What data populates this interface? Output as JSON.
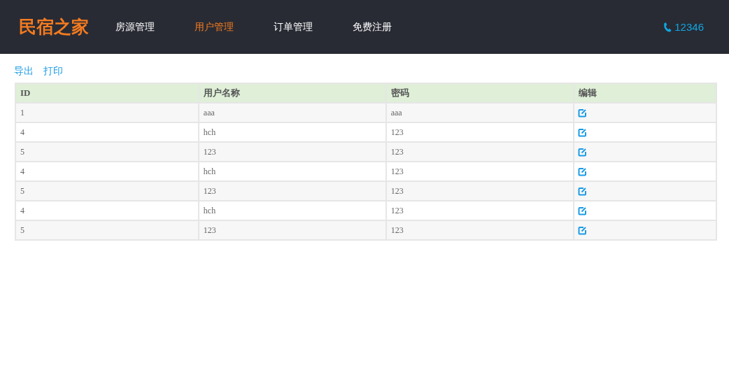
{
  "header": {
    "logo": "民宿之家",
    "nav": [
      {
        "label": "房源管理",
        "selected": false
      },
      {
        "label": "用户管理",
        "selected": true
      },
      {
        "label": "订单管理",
        "selected": false
      },
      {
        "label": "免费注册",
        "selected": false
      }
    ],
    "phone": "12346"
  },
  "actions": [
    "导出",
    "打印"
  ],
  "table": {
    "columns": [
      "ID",
      "用户名称",
      "密码",
      "编辑"
    ],
    "rows": [
      [
        "1",
        "aaa",
        "aaa"
      ],
      [
        "4",
        "hch",
        "123"
      ],
      [
        "5",
        "123",
        "123"
      ],
      [
        "4",
        "hch",
        "123"
      ],
      [
        "5",
        "123",
        "123"
      ],
      [
        "4",
        "hch",
        "123"
      ],
      [
        "5",
        "123",
        "123"
      ]
    ]
  }
}
